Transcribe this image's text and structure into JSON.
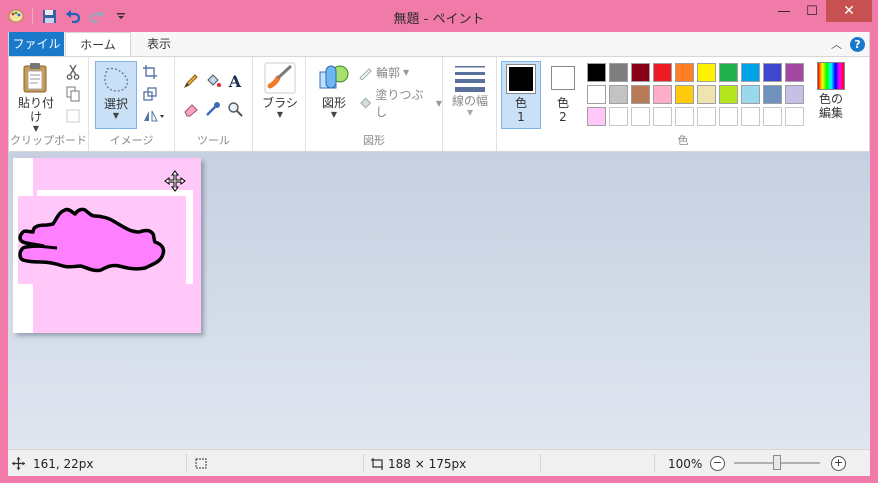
{
  "window": {
    "title": "無題 - ペイント",
    "close_label": "✕",
    "minimize_label": "—",
    "maximize_label": "☐"
  },
  "tabs": [
    {
      "label": "ファイル"
    },
    {
      "label": "ホーム"
    },
    {
      "label": "表示"
    }
  ],
  "ribbon": {
    "clipboard": {
      "paste_label": "貼り付け",
      "group_label": "クリップボード"
    },
    "image": {
      "select_label": "選択",
      "group_label": "イメージ"
    },
    "tools": {
      "group_label": "ツール"
    },
    "brushes": {
      "label": "ブラシ"
    },
    "shapes": {
      "shapes_label": "図形",
      "outline_label": "輪郭",
      "fill_label": "塗りつぶし",
      "group_label": "図形"
    },
    "size": {
      "label": "線の幅"
    },
    "colors": {
      "color1_label": "色",
      "color1_num": "1",
      "color2_label": "色",
      "color2_num": "2",
      "edit_label_1": "色の",
      "edit_label_2": "編集",
      "group_label": "色",
      "color1_value": "#000000",
      "color2_value": "#ffffff",
      "palette_row1": [
        "#000000",
        "#7f7f7f",
        "#880015",
        "#ed1c24",
        "#ff7f27",
        "#fff200",
        "#22b14c",
        "#00a2e8",
        "#3f48cc",
        "#a349a4"
      ],
      "palette_row2": [
        "#ffffff",
        "#c3c3c3",
        "#b97a57",
        "#ffaec9",
        "#ffc90e",
        "#efe4b0",
        "#b5e61d",
        "#99d9ea",
        "#7092be",
        "#c8bfe7"
      ],
      "palette_row3": [
        "#ffc8f8"
      ]
    }
  },
  "status": {
    "cursor_pos": "161, 22px",
    "image_size": "188 × 175px",
    "zoom": "100%",
    "zoom_level": 0.5
  }
}
